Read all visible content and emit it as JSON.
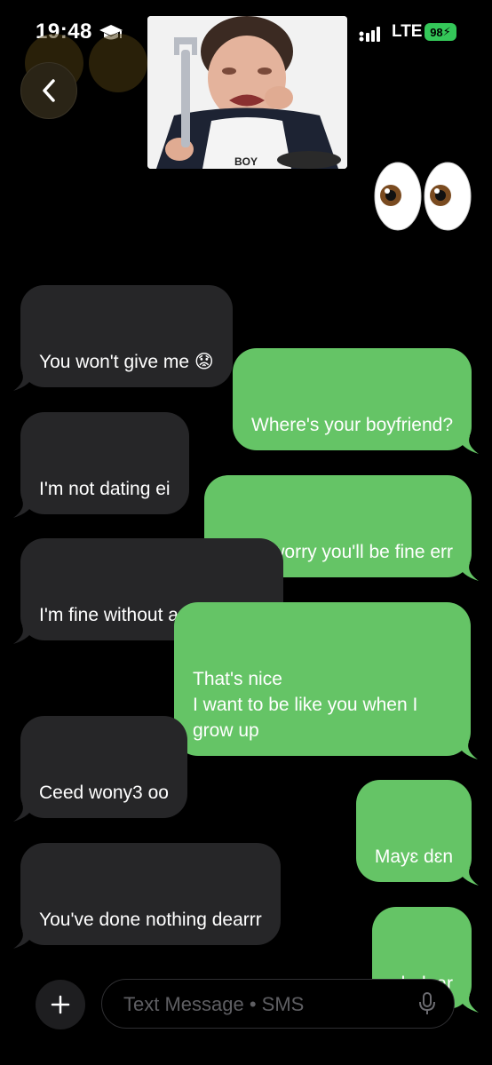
{
  "status_bar": {
    "time": "19:48",
    "network": "LTE",
    "battery": "98"
  },
  "icons": {
    "back": "chevron-left-icon",
    "status_extra": "graduation-cap-icon",
    "signal": "signal-bars-icon",
    "plus": "plus-icon",
    "mic": "microphone-icon"
  },
  "colors": {
    "incoming_bubble": "#262628",
    "outgoing_bubble": "#65c466",
    "battery": "#34c759"
  },
  "messages": [
    {
      "direction": "in",
      "text": "You won't give me 😟"
    },
    {
      "direction": "out",
      "text": "Where's your boyfriend?"
    },
    {
      "direction": "in",
      "text": "I'm not dating ei"
    },
    {
      "direction": "out",
      "text": "Don't worry you'll be fine err"
    },
    {
      "direction": "in",
      "text": "I'm fine without any guy tho"
    },
    {
      "direction": "out",
      "text": "That's nice\nI want to be like you when I grow up"
    },
    {
      "direction": "in",
      "text": "Ceed wony3 oo"
    },
    {
      "direction": "out",
      "text": "Mayɛ dɛn"
    },
    {
      "direction": "in",
      "text": "You've done nothing dearrr"
    },
    {
      "direction": "out",
      "text": "ok dear"
    }
  ],
  "composer": {
    "placeholder": "Text Message • SMS"
  }
}
